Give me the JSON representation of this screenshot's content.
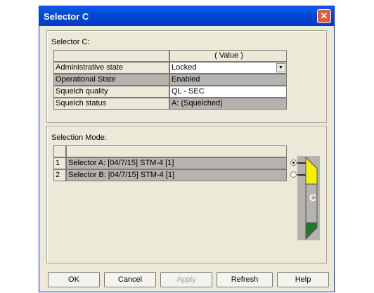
{
  "window": {
    "title": "Selector C",
    "close_glyph": "✕"
  },
  "selector_group": {
    "label": "Selector C:",
    "value_header": "( Value )",
    "rows": [
      {
        "label": "Administrative state",
        "value": "Locked"
      },
      {
        "label": "Operational State",
        "value": "Enabled"
      },
      {
        "label": "Squelch quality",
        "value": "QL - SEC"
      },
      {
        "label": "Squelch status",
        "value": "A: (Squelched)"
      }
    ]
  },
  "selection_group": {
    "label": "Selection Mode:",
    "rows": [
      {
        "index": "1",
        "name": "Selector A: [04/7/15] STM-4 [1]"
      },
      {
        "index": "2",
        "name": "Selector B: [04/7/15] STM-4 [1]"
      }
    ],
    "switch_label": "C"
  },
  "buttons": {
    "ok": "OK",
    "cancel": "Cancel",
    "apply": "Apply",
    "refresh": "Refresh",
    "help": "Help"
  },
  "icons": {
    "close": "close-icon",
    "dropdown": "chevron-down-icon",
    "selector_switch": "selector-switch-icon"
  },
  "colors": {
    "title_bar": "#0248d6",
    "close_button": "#e05a3c",
    "switch_yellow": "#f7f000",
    "switch_green": "#1f7a2a"
  }
}
